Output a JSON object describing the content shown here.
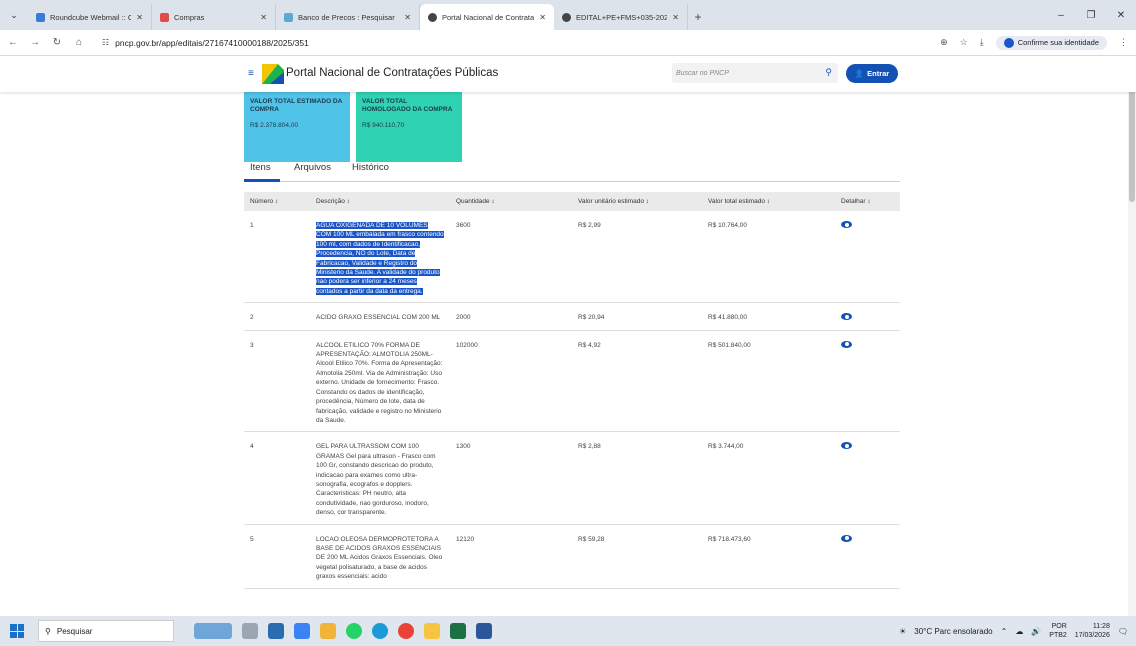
{
  "browser": {
    "tabs": [
      {
        "title": "Roundcube Webmail :: Caixa de",
        "color": "#3a7bd5"
      },
      {
        "title": "Compras",
        "color": "#e24b4b"
      },
      {
        "title": "Banco de Precos : Pesquisar",
        "color": "#5fa8d3"
      },
      {
        "title": "Portal Nacional de Contrataçõe",
        "color": "#444444"
      },
      {
        "title": "EDITAL+PE+FMS+035-2025+-",
        "color": "#444444"
      }
    ],
    "url": "pncp.gov.br/app/editais/27167410000188/2025/351",
    "identity_label": "Confirme sua identidade"
  },
  "header": {
    "portal_title": "Portal Nacional de Contratações Públicas",
    "search_placeholder": "Buscar no PNCP",
    "login_label": "Entrar"
  },
  "cards": {
    "estimado_label": "VALOR TOTAL ESTIMADO DA COMPRA",
    "estimado_value": "R$ 2.378.804,00",
    "homologado_label": "VALOR TOTAL HOMOLOGADO DA COMPRA",
    "homologado_value": "R$ 940.110,70"
  },
  "tabs": {
    "itens": "Itens",
    "arquivos": "Arquivos",
    "historico": "Histórico"
  },
  "table": {
    "headers": [
      "Número ↕",
      "Descrição ↕",
      "Quantidade ↕",
      "Valor unitário estimado ↕",
      "Valor total estimado ↕",
      "Detalhar ↕"
    ],
    "rows": [
      {
        "num": "1",
        "desc": "AGUA OXIGENADA DE 10 VOLUMES COM 100 ML embalada em frasco contendo 100 ml, com dados de Identificacao, Procedencia, NO do Lote, Data de Fabricacao, Validade e Registro do Ministerio da Saude. A validade do produto nao podera ser inferior a 24 meses contados a partir da data da entrega.",
        "qty": "3600",
        "unit": "R$ 2,99",
        "total": "R$ 10.764,00"
      },
      {
        "num": "2",
        "desc": "ACIDO GRAXO ESSENCIAL COM 200 ML",
        "qty": "2000",
        "unit": "R$ 20,94",
        "total": "R$ 41.880,00"
      },
      {
        "num": "3",
        "desc": "ALCOOL ETILICO 70% FORMA DE APRESENTAÇÃO: ALMOTOLIA 250ML- Alcool Etilico 70%. Forma de Apresentação: Almotolia 250ml. Via de Administração: Uso externo. Unidade de fornecimento: Frasco. Constando os dados de identificação, procedência, Número de lote, data de fabricação, validade e registro no Ministerio da Saude.",
        "qty": "102000",
        "unit": "R$ 4,92",
        "total": "R$ 501.840,00"
      },
      {
        "num": "4",
        "desc": "GEL PARA ULTRASSOM COM 100 GRAMAS Gel para ultrason - Frasco com 100 Gr, constando descricao do produto, indicacao para exames como ultra-sonografia, ecografos e dopplers. Caracteristicas: PH neutro, alta condutividade, nao gorduroso, inodoro, denso, cor transparente.",
        "qty": "1300",
        "unit": "R$ 2,88",
        "total": "R$ 3.744,00"
      },
      {
        "num": "5",
        "desc": "LOCAO OLEOSA DERMOPROTETORA A BASE DE ACIDOS GRAXOS ESSENCIAIS DE 200 ML Acidos Graxos Essenciais. Oleo vegetal polisaturado, a base de acidos graxos essenciais: acido",
        "qty": "12120",
        "unit": "R$ 59,28",
        "total": "R$ 718.473,60"
      }
    ]
  },
  "taskbar": {
    "search_label": "Pesquisar",
    "weather": "30°C  Parc ensolarado",
    "lang_top": "POR",
    "lang_bottom": "PTB2",
    "time": "11:28",
    "date": "17/03/2026"
  }
}
